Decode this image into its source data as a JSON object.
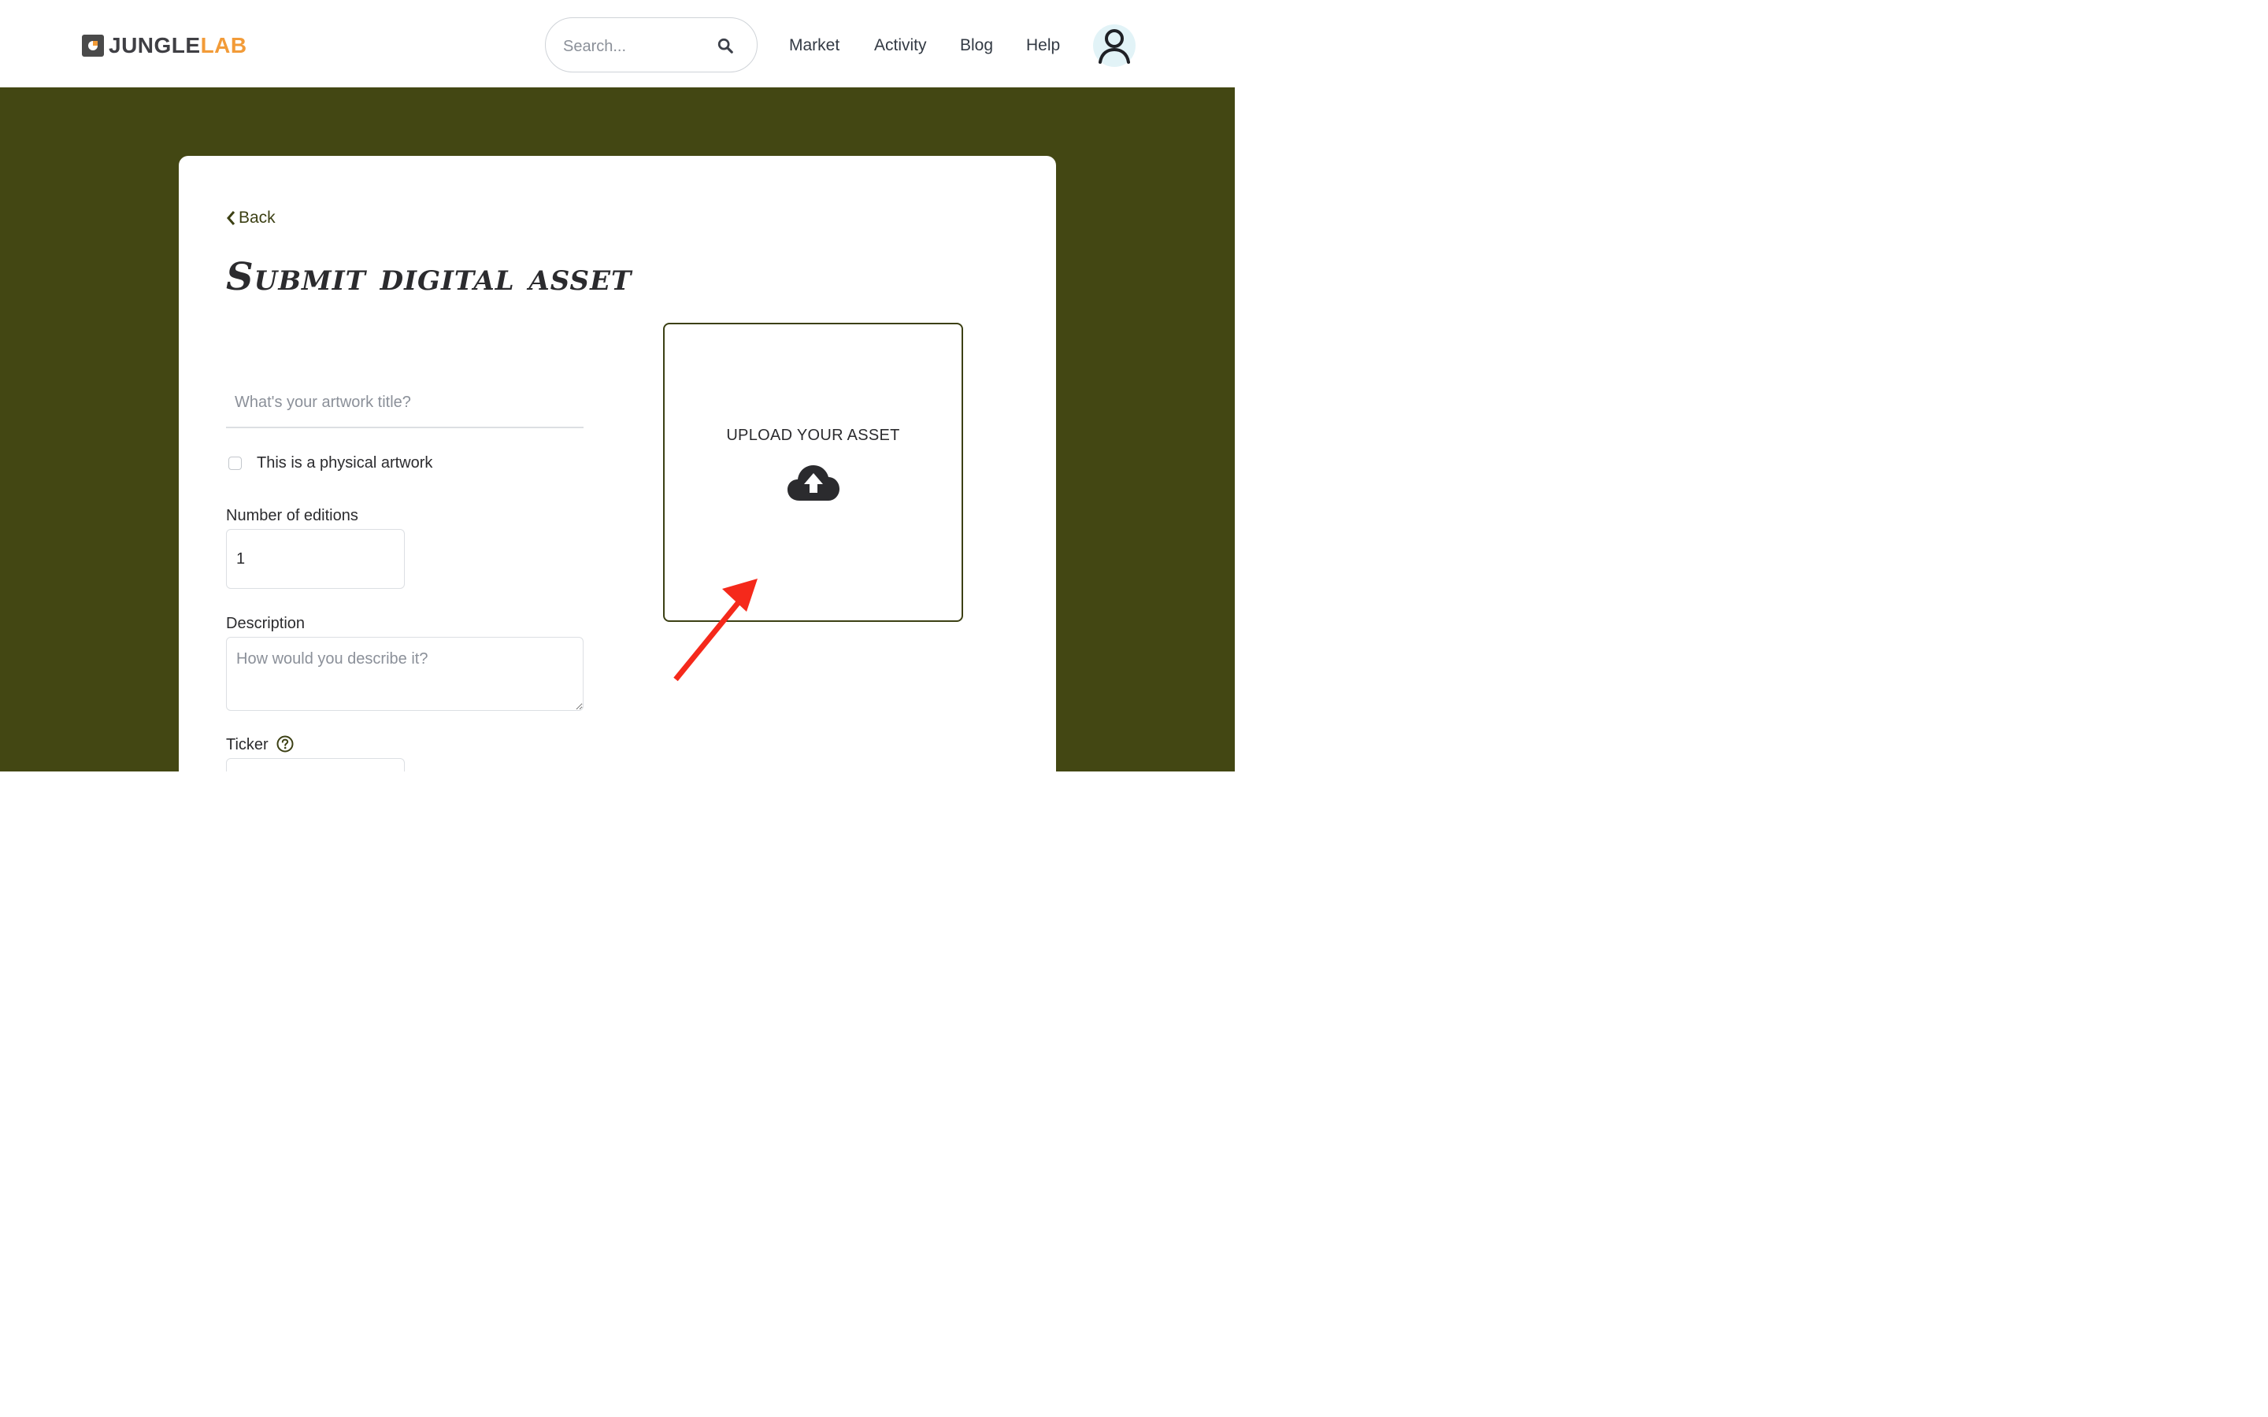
{
  "brand": {
    "name_part1": "JUNGLE",
    "name_part2": "LAB",
    "accent_color": "#f29b38",
    "dark_color": "#3f3f44",
    "logo_icon": "junglelab-logo-icon"
  },
  "header": {
    "search": {
      "placeholder": "Search...",
      "value": "",
      "icon": "search-icon"
    },
    "nav": [
      {
        "label": "Market"
      },
      {
        "label": "Activity"
      },
      {
        "label": "Blog"
      },
      {
        "label": "Help"
      }
    ],
    "avatar_icon": "user-icon"
  },
  "theme": {
    "background_color": "#434713",
    "card_color": "#ffffff",
    "annotation_arrow_color": "#f5291b"
  },
  "form": {
    "back_label": "Back",
    "back_icon": "chevron-left-icon",
    "title": "Submit digital asset",
    "artwork_title": {
      "placeholder": "What's your artwork title?",
      "value": ""
    },
    "physical_checkbox": {
      "label": "This is a physical artwork",
      "checked": false
    },
    "editions": {
      "label": "Number of editions",
      "value": "1"
    },
    "description": {
      "label": "Description",
      "placeholder": "How would you describe it?",
      "value": ""
    },
    "ticker": {
      "label": "Ticker",
      "help_icon": "question-circle-icon",
      "value": ""
    },
    "upload": {
      "label": "UPLOAD YOUR ASSET",
      "icon": "cloud-upload-icon"
    }
  }
}
